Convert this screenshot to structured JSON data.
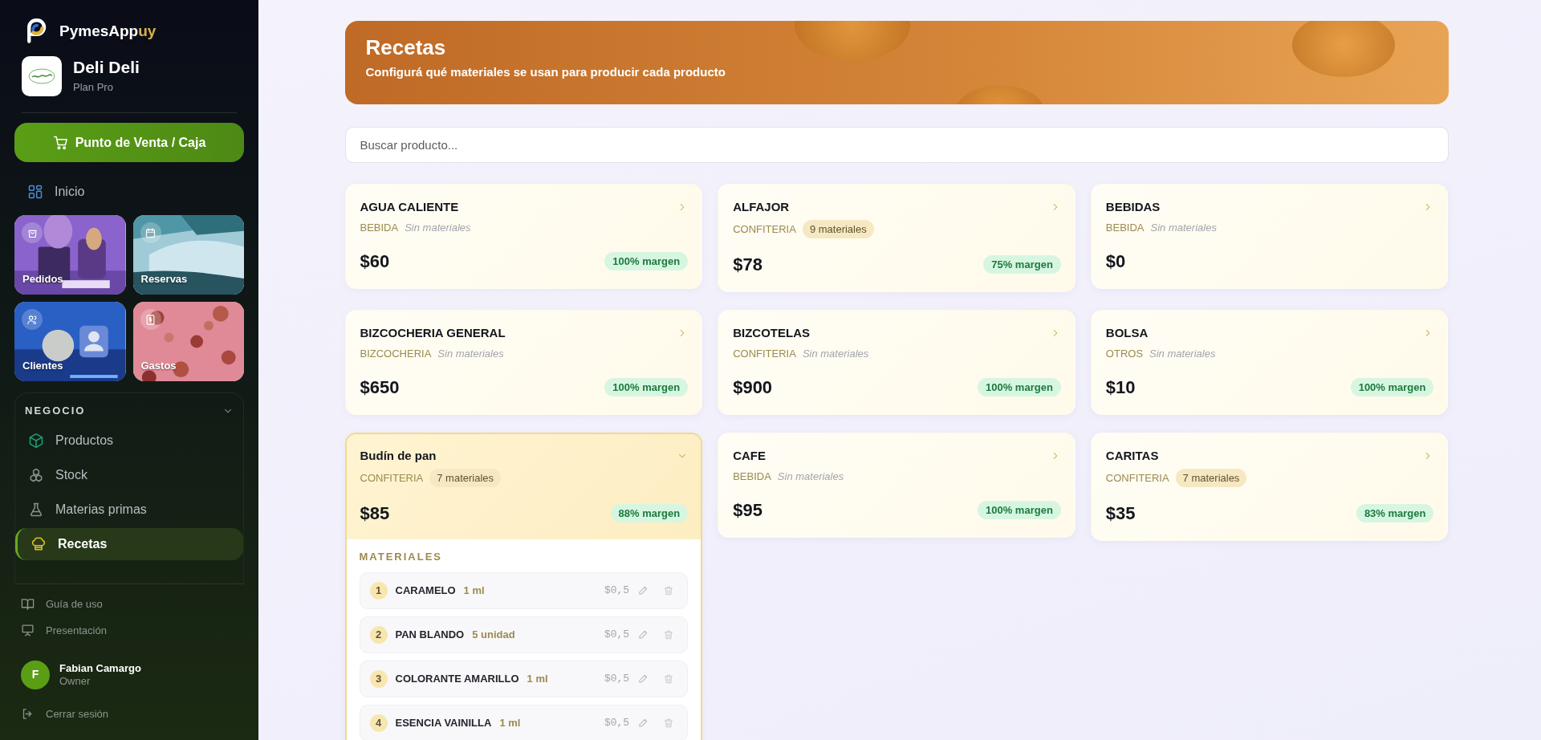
{
  "brand": {
    "name": "PymesApp",
    "suffix": "uy"
  },
  "business": {
    "name": "Deli Deli",
    "plan": "Plan Pro"
  },
  "pos_button": {
    "label": "Punto de Venta / Caja"
  },
  "home": {
    "label": "Inicio",
    "selected": false
  },
  "tiles": [
    {
      "label": "Pedidos",
      "kind": "orders",
      "color": "#8a63cc"
    },
    {
      "label": "Reservas",
      "kind": "bookings",
      "color": "#4f97a6"
    },
    {
      "label": "Clientes",
      "kind": "clients",
      "color": "#2a5fc4"
    },
    {
      "label": "Gastos",
      "kind": "expenses",
      "color": "#e08a98"
    }
  ],
  "section": {
    "title": "NEGOCIO",
    "expanded": true,
    "items": [
      {
        "label": "Productos",
        "kind": "box",
        "selected": false
      },
      {
        "label": "Stock",
        "kind": "blocks",
        "selected": false
      },
      {
        "label": "Materias primas",
        "kind": "flask",
        "selected": false
      },
      {
        "label": "Recetas",
        "kind": "chef",
        "selected": true
      }
    ]
  },
  "footer_links": [
    {
      "label": "Guía de uso",
      "kind": "book"
    },
    {
      "label": "Presentación",
      "kind": "screen"
    }
  ],
  "user": {
    "initial": "F",
    "name": "Fabian Camargo",
    "role": "Owner"
  },
  "logout": {
    "label": "Cerrar sesión"
  },
  "header": {
    "title": "Recetas",
    "subtitle": "Configurá qué materiales se usan para producir cada producto"
  },
  "search": {
    "placeholder": "Buscar producto..."
  },
  "products": [
    {
      "name": "AGUA CALIENTE",
      "category": "BEBIDA",
      "materials": "Sin materiales",
      "has_materials": false,
      "price": "$60",
      "margin": "100% margen",
      "expanded": false
    },
    {
      "name": "ALFAJOR",
      "category": "CONFITERIA",
      "materials": "9 materiales",
      "has_materials": true,
      "price": "$78",
      "margin": "75% margen",
      "expanded": false
    },
    {
      "name": "BEBIDAS",
      "category": "BEBIDA",
      "materials": "Sin materiales",
      "has_materials": false,
      "price": "$0",
      "expanded": false
    },
    {
      "name": "BIZCOCHERIA GENERAL",
      "category": "BIZCOCHERIA",
      "materials": "Sin materiales",
      "has_materials": false,
      "price": "$650",
      "margin": "100% margen",
      "expanded": false
    },
    {
      "name": "BIZCOTELAS",
      "category": "CONFITERIA",
      "materials": "Sin materiales",
      "has_materials": false,
      "price": "$900",
      "margin": "100% margen",
      "expanded": false
    },
    {
      "name": "BOLSA",
      "category": "OTROS",
      "materials": "Sin materiales",
      "has_materials": false,
      "price": "$10",
      "margin": "100% margen",
      "expanded": false
    },
    {
      "name": "Budín de pan",
      "category": "CONFITERIA",
      "materials": "7 materiales",
      "has_materials": true,
      "price": "$85",
      "margin": "88% margen",
      "expanded": true,
      "detail": {
        "title": "MATERIALES",
        "items": [
          {
            "number": "1",
            "name": "CARAMELO",
            "qty": "1 ml",
            "cost": "$0,5"
          },
          {
            "number": "2",
            "name": "PAN BLANDO",
            "qty": "5 unidad",
            "cost": "$0,5"
          },
          {
            "number": "3",
            "name": "COLORANTE AMARILLO",
            "qty": "1 ml",
            "cost": "$0,5"
          },
          {
            "number": "4",
            "name": "ESENCIA VAINILLA",
            "qty": "1 ml",
            "cost": "$0,5"
          }
        ]
      }
    },
    {
      "name": "CAFE",
      "category": "BEBIDA",
      "materials": "Sin materiales",
      "has_materials": false,
      "price": "$95",
      "margin": "100% margen",
      "expanded": false
    },
    {
      "name": "CARITAS",
      "category": "CONFITERIA",
      "materials": "7 materiales",
      "has_materials": true,
      "price": "$35",
      "margin": "83% margen",
      "expanded": false
    }
  ]
}
